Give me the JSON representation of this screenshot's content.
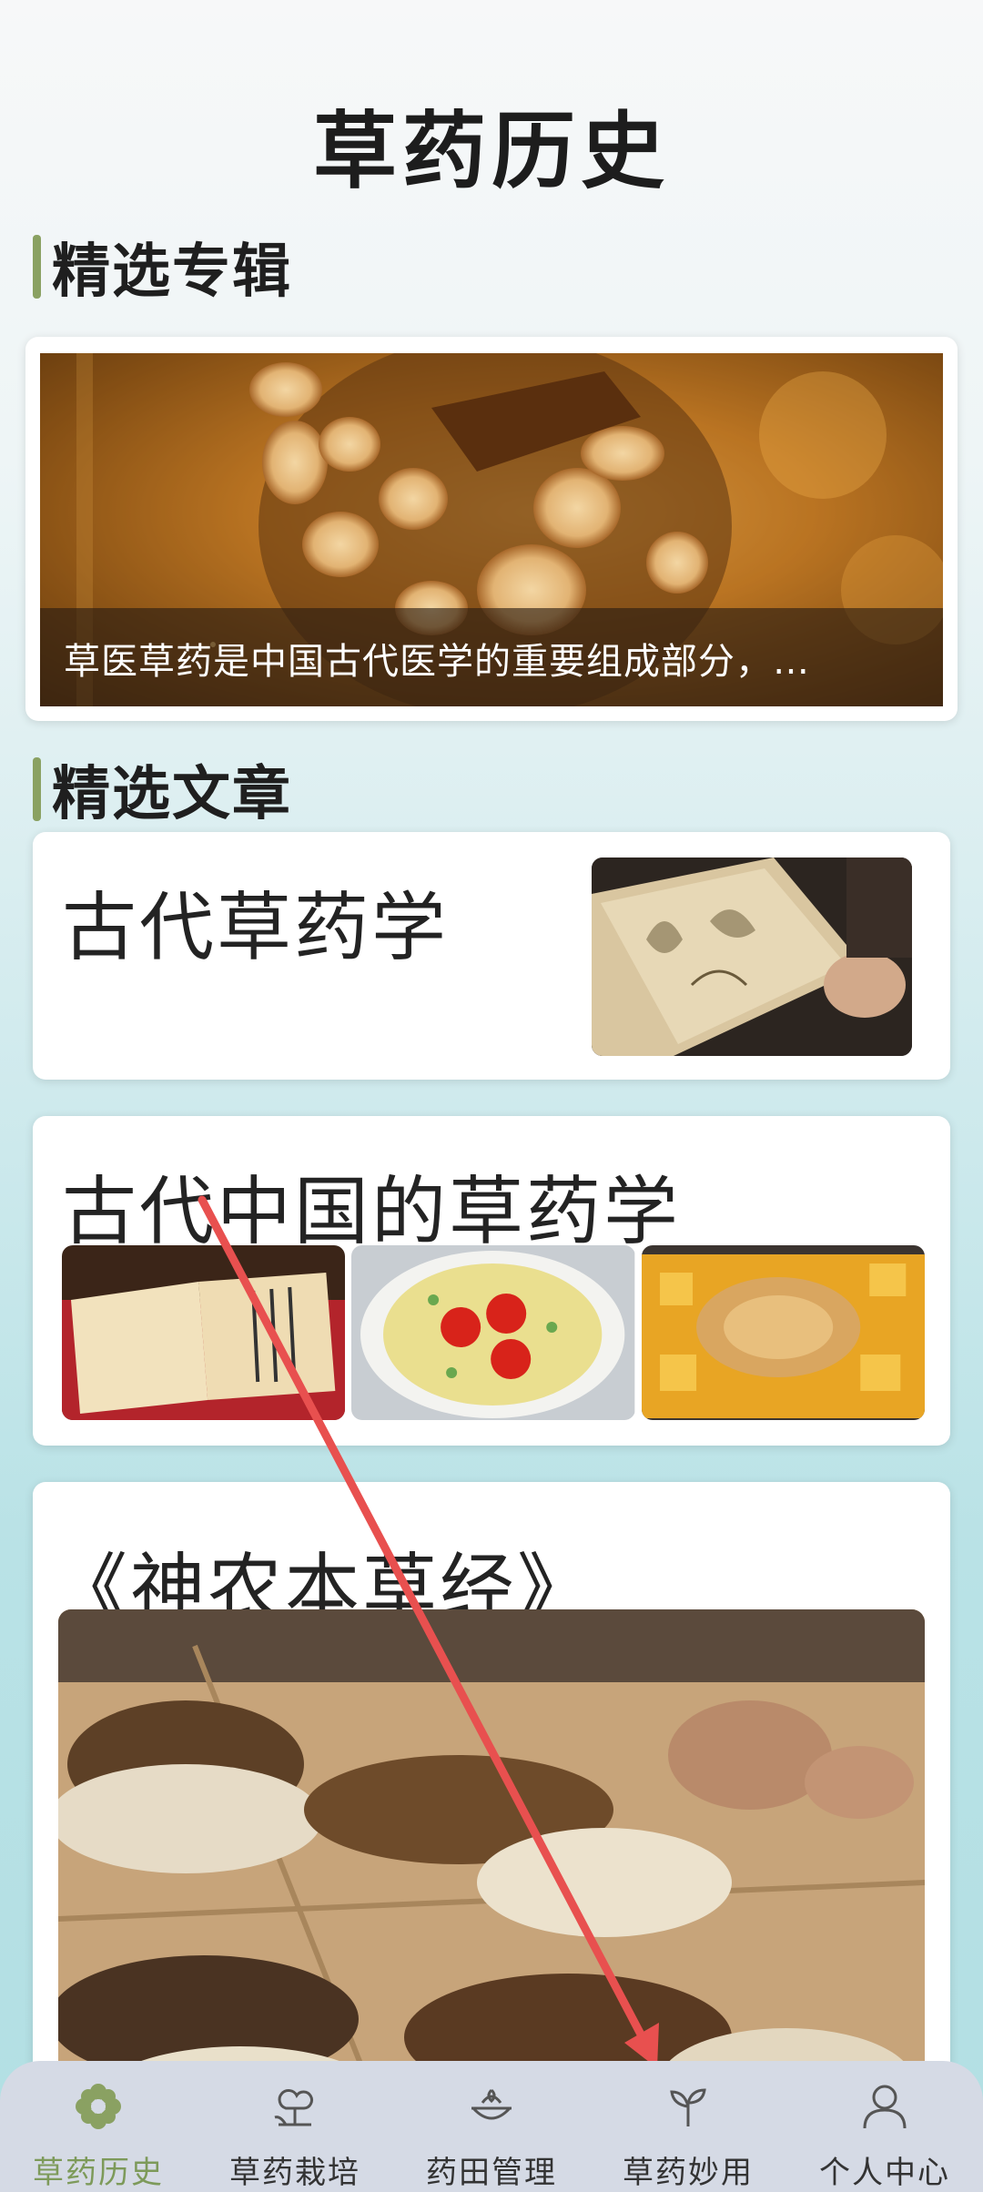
{
  "page": {
    "title": "草药历史"
  },
  "sections": {
    "featured": "精选专辑",
    "articles": "精选文章"
  },
  "banner": {
    "caption": "草医草药是中国古代医学的重要组成部分，…"
  },
  "articles": [
    {
      "title": "古代草药学"
    },
    {
      "title": "古代中国的草药学"
    },
    {
      "title": "《神农本草经》"
    }
  ],
  "tabbar": {
    "items": [
      {
        "label": "草药历史",
        "icon": "flower-icon",
        "active": true
      },
      {
        "label": "草药栽培",
        "icon": "plant-tree-icon",
        "active": false
      },
      {
        "label": "药田管理",
        "icon": "field-bowl-icon",
        "active": false
      },
      {
        "label": "草药妙用",
        "icon": "sprout-icon",
        "active": false
      },
      {
        "label": "个人中心",
        "icon": "person-icon",
        "active": false
      }
    ],
    "active_color": "#7d9a5a"
  },
  "colors": {
    "section_bar": "#8aa162",
    "annotation_arrow": "#e8504f"
  }
}
